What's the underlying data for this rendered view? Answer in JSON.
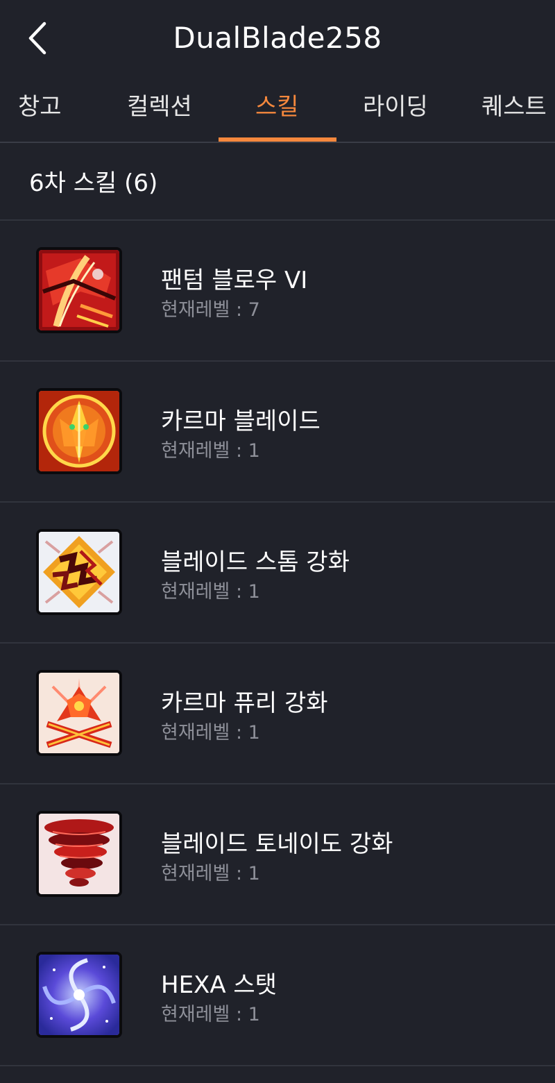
{
  "header": {
    "title": "DualBlade258"
  },
  "tabs": [
    {
      "label": "창고",
      "active": false
    },
    {
      "label": "컬렉션",
      "active": false
    },
    {
      "label": "스킬",
      "active": true
    },
    {
      "label": "라이딩",
      "active": false
    },
    {
      "label": "퀘스트",
      "active": false
    }
  ],
  "colors": {
    "accent": "#f5883d",
    "background": "#20222a",
    "divider": "#31343d",
    "secondary_text": "#8e9099"
  },
  "section": {
    "title": "6차 스킬 (6)"
  },
  "skills": [
    {
      "name": "팬텀 블로우 VI",
      "level_text": "현재레벨 : 7",
      "icon": "phantom-blow-icon"
    },
    {
      "name": "카르마 블레이드",
      "level_text": "현재레벨 : 1",
      "icon": "karma-blade-icon"
    },
    {
      "name": "블레이드 스톰 강화",
      "level_text": "현재레벨 : 1",
      "icon": "blade-storm-icon"
    },
    {
      "name": "카르마 퓨리 강화",
      "level_text": "현재레벨 : 1",
      "icon": "karma-fury-icon"
    },
    {
      "name": "블레이드 토네이도 강화",
      "level_text": "현재레벨 : 1",
      "icon": "blade-tornado-icon"
    },
    {
      "name": "HEXA 스탯",
      "level_text": "현재레벨 : 1",
      "icon": "hexa-stat-icon"
    }
  ]
}
